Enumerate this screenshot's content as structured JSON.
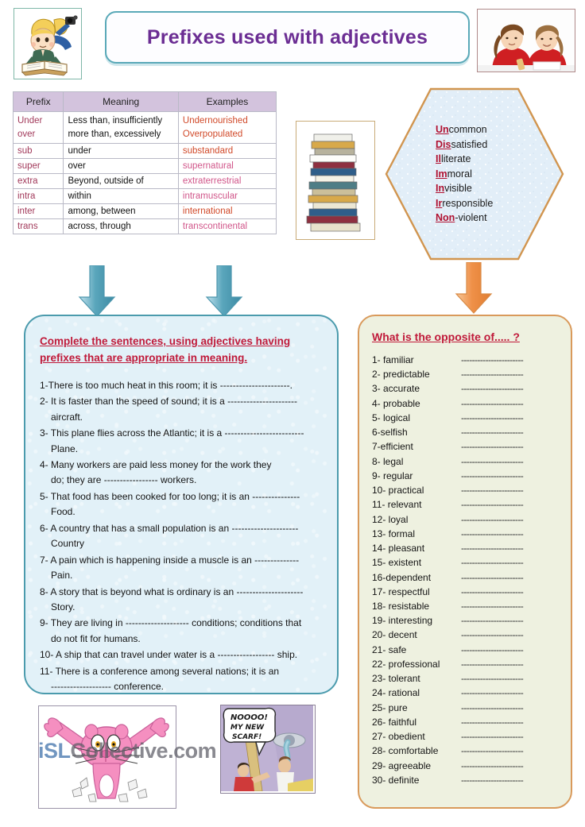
{
  "header": {
    "title": "Prefixes used with adjectives",
    "left_image": "girl-reading-book-illustration",
    "right_image": "two-girls-studying-photo"
  },
  "prefix_table": {
    "columns": [
      "Prefix",
      "Meaning",
      "Examples"
    ],
    "rows": [
      {
        "prefix": "Under",
        "meaning": "Less than, insufficiently",
        "example": "Undernourished"
      },
      {
        "prefix": "over",
        "meaning": "more than, excessively",
        "example": "Overpopulated"
      },
      {
        "prefix": "sub",
        "meaning": "under",
        "example": "substandard"
      },
      {
        "prefix": "super",
        "meaning": "over",
        "example": "supernatural"
      },
      {
        "prefix": "extra",
        "meaning": "Beyond, outside of",
        "example": "extraterrestrial"
      },
      {
        "prefix": "intra",
        "meaning": "within",
        "example": "intramuscular"
      },
      {
        "prefix": "inter",
        "meaning": "among, between",
        "example": "international"
      },
      {
        "prefix": "trans",
        "meaning": "across, through",
        "example": "transcontinental"
      }
    ]
  },
  "books_image": "stack-of-books-photo",
  "hexagon": {
    "items": [
      {
        "prefix": "Un",
        "rest": "common"
      },
      {
        "prefix": "Dis",
        "rest": "satisfied"
      },
      {
        "prefix": "Il",
        "rest": "literate"
      },
      {
        "prefix": "Im",
        "rest": "moral"
      },
      {
        "prefix": "In",
        "rest": "visible"
      },
      {
        "prefix": "Ir",
        "rest": "responsible"
      },
      {
        "prefix": "Non",
        "rest": "-violent"
      }
    ]
  },
  "exercise": {
    "heading": "Complete the sentences, using adjectives having prefixes that are appropriate in meaning.",
    "items": [
      {
        "main": "1-There is too much heat in this room; it is ----------------------.",
        "cont": ""
      },
      {
        "main": "2- It is faster than the speed of sound; it is a ----------------------",
        "cont": "aircraft."
      },
      {
        "main": "3- This plane flies across the Atlantic; it is a -------------------------",
        "cont": "Plane."
      },
      {
        "main": "4- Many workers are paid less money for the work they",
        "cont": "do; they are ----------------- workers."
      },
      {
        "main": "5- That food has been cooked for too long; it is an ---------------",
        "cont": "Food."
      },
      {
        "main": "6- A country that has a small population is an ---------------------",
        "cont": "Country"
      },
      {
        "main": "7- A pain which is happening inside a muscle is an --------------",
        "cont": "Pain."
      },
      {
        "main": "8- A story that is beyond what is ordinary is an ---------------------",
        "cont": "Story."
      },
      {
        "main": "9- They are living in -------------------- conditions; conditions that",
        "cont": "do not fit for humans."
      },
      {
        "main": "10- A ship that can travel under water is a ------------------ ship.",
        "cont": ""
      },
      {
        "main": "11- There is a conference among several nations; it is an",
        "cont": "------------------- conference."
      }
    ]
  },
  "opposites": {
    "heading": "What is the opposite of..... ?",
    "blank": "-----------------------",
    "items": [
      "1- familiar",
      "2- predictable",
      "3- accurate",
      "4- probable",
      "5- logical",
      "6-selfish",
      "7-efficient",
      "8- legal",
      "9- regular",
      "10- practical",
      "11- relevant",
      "12- loyal",
      "13- formal",
      "14- pleasant",
      "15- existent",
      "16-dependent",
      "17- respectful",
      "18- resistable",
      "19- interesting",
      "20- decent",
      "21- safe",
      "22- professional",
      "23- tolerant",
      "24- rational",
      "25- pure",
      "26- faithful",
      "27- obedient",
      "28- comfortable",
      "29- agreeable",
      "30- definite"
    ]
  },
  "footer": {
    "panther_image": "pink-panther-bursting-through-wall-cartoon",
    "comic_image": "noooo-my-new-scarf-cartoon",
    "comic_text": "NOOOO! MY NEW SCARF!",
    "watermark_prefix": "iSL",
    "watermark_suffix": "Collective.com"
  },
  "colors": {
    "title_purple": "#6b2d93",
    "teal_border": "#4b9bad",
    "orange_border": "#d99a5b",
    "heading_red": "#c01a3a",
    "table_header": "#d3c3dd",
    "prefix_red": "#a23a5b",
    "example_orange": "#d14a2a"
  }
}
